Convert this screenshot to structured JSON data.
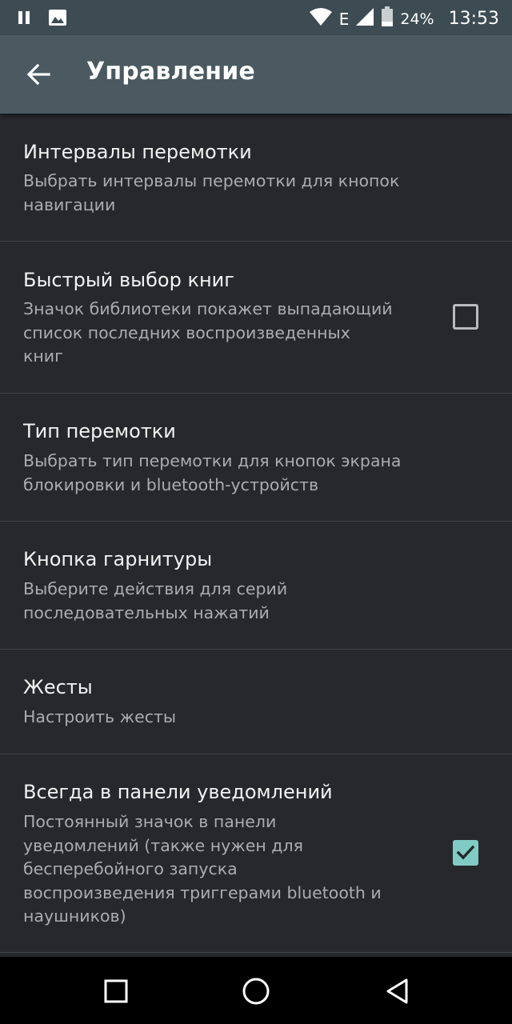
{
  "status_bar": {
    "network_type": "E",
    "battery_percent": "24%",
    "time": "13:53",
    "icons": [
      "pause-icon",
      "image-icon",
      "wifi-icon",
      "signal-icon",
      "battery-icon"
    ]
  },
  "toolbar": {
    "title": "Управление",
    "back_icon": "arrow-back-icon"
  },
  "settings": {
    "items": [
      {
        "title": "Интервалы перемотки",
        "summary_lines": [
          "Выбрать интервалы перемотки для кнопок",
          "навигации"
        ]
      },
      {
        "title": "Быстрый выбор книг",
        "summary_lines": [
          "Значок библиотеки покажет выпадающий",
          "список последних воспроизведенных",
          "книг"
        ],
        "checked": false
      },
      {
        "title": "Тип перемотки",
        "summary_lines": [
          "Выбрать тип перемотки для кнопок экрана",
          "блокировки и bluetooth-устройств"
        ]
      },
      {
        "title": "Кнопка гарнитуры",
        "summary_lines": [
          "Выберите действия для серий",
          "последовательных нажатий"
        ]
      },
      {
        "title": "Жесты",
        "summary_lines": [
          "Настроить жесты"
        ]
      },
      {
        "title": "Всегда в панели уведомлений",
        "summary_lines": [
          "Постоянный значок в панели",
          "уведомлений (также нужен для",
          "бесперебойного запуска",
          "воспроизведения триггерами bluetooth и",
          "наушников)"
        ],
        "checked": true
      }
    ]
  },
  "nav_bar": {
    "icons": [
      "recents-square-icon",
      "home-circle-icon",
      "back-triangle-icon"
    ]
  },
  "colors": {
    "background": "#27282c",
    "toolbar": "#4a5a60",
    "status_bar": "#3d4c52",
    "accent": "#80cbc4",
    "divider": "#44464b"
  }
}
